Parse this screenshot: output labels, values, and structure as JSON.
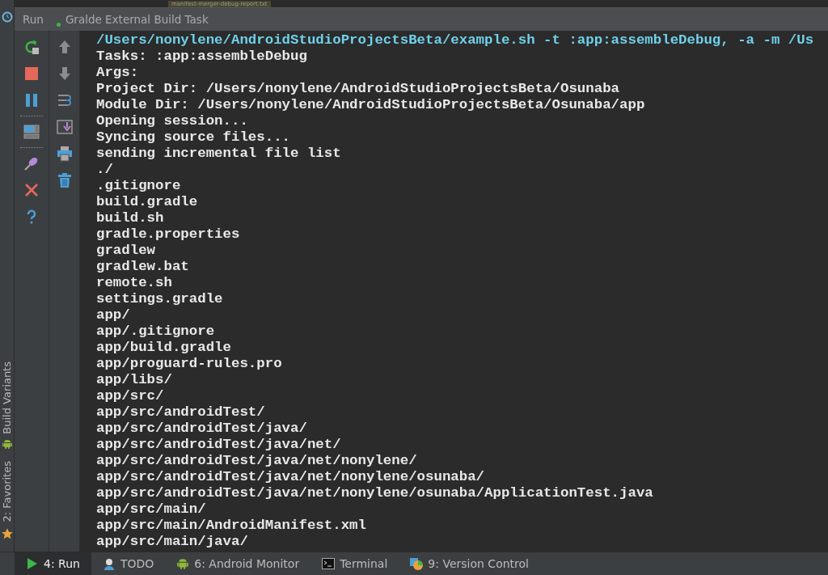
{
  "editor_tab": {
    "title": "manifest-merger-debug-report.txt"
  },
  "run_panel": {
    "title": "Run",
    "task": "Gralde External Build Task",
    "running": true
  },
  "side_tabs": [
    {
      "label": "Build Variants",
      "kind": "android"
    },
    {
      "label": "2: Favorites",
      "kind": "star"
    }
  ],
  "console": {
    "lines": [
      {
        "text": "/Users/nonylene/AndroidStudioProjectsBeta/example.sh -t :app:assembleDebug, -a -m /Us",
        "kind": "command"
      },
      {
        "text": "Tasks: :app:assembleDebug",
        "kind": "output"
      },
      {
        "text": "Args:",
        "kind": "output"
      },
      {
        "text": "Project Dir: /Users/nonylene/AndroidStudioProjectsBeta/Osunaba",
        "kind": "output"
      },
      {
        "text": "Module Dir: /Users/nonylene/AndroidStudioProjectsBeta/Osunaba/app",
        "kind": "output"
      },
      {
        "text": "Opening session...",
        "kind": "output"
      },
      {
        "text": "Syncing source files...",
        "kind": "output"
      },
      {
        "text": "sending incremental file list",
        "kind": "output"
      },
      {
        "text": "./",
        "kind": "output"
      },
      {
        "text": ".gitignore",
        "kind": "output"
      },
      {
        "text": "build.gradle",
        "kind": "output"
      },
      {
        "text": "build.sh",
        "kind": "output"
      },
      {
        "text": "gradle.properties",
        "kind": "output"
      },
      {
        "text": "gradlew",
        "kind": "output"
      },
      {
        "text": "gradlew.bat",
        "kind": "output"
      },
      {
        "text": "remote.sh",
        "kind": "output"
      },
      {
        "text": "settings.gradle",
        "kind": "output"
      },
      {
        "text": "app/",
        "kind": "output"
      },
      {
        "text": "app/.gitignore",
        "kind": "output"
      },
      {
        "text": "app/build.gradle",
        "kind": "output"
      },
      {
        "text": "app/proguard-rules.pro",
        "kind": "output"
      },
      {
        "text": "app/libs/",
        "kind": "output"
      },
      {
        "text": "app/src/",
        "kind": "output"
      },
      {
        "text": "app/src/androidTest/",
        "kind": "output"
      },
      {
        "text": "app/src/androidTest/java/",
        "kind": "output"
      },
      {
        "text": "app/src/androidTest/java/net/",
        "kind": "output"
      },
      {
        "text": "app/src/androidTest/java/net/nonylene/",
        "kind": "output"
      },
      {
        "text": "app/src/androidTest/java/net/nonylene/osunaba/",
        "kind": "output"
      },
      {
        "text": "app/src/androidTest/java/net/nonylene/osunaba/ApplicationTest.java",
        "kind": "output"
      },
      {
        "text": "app/src/main/",
        "kind": "output"
      },
      {
        "text": "app/src/main/AndroidManifest.xml",
        "kind": "output"
      },
      {
        "text": "app/src/main/java/",
        "kind": "output"
      }
    ]
  },
  "bottom_tabs": [
    {
      "label": "4: Run",
      "kind": "run",
      "selected": true
    },
    {
      "label": "TODO",
      "kind": "todo",
      "selected": false
    },
    {
      "label": "6: Android Monitor",
      "kind": "android",
      "selected": false
    },
    {
      "label": "Terminal",
      "kind": "terminal",
      "selected": false
    },
    {
      "label": "9: Version Control",
      "kind": "vcs",
      "selected": false
    }
  ]
}
